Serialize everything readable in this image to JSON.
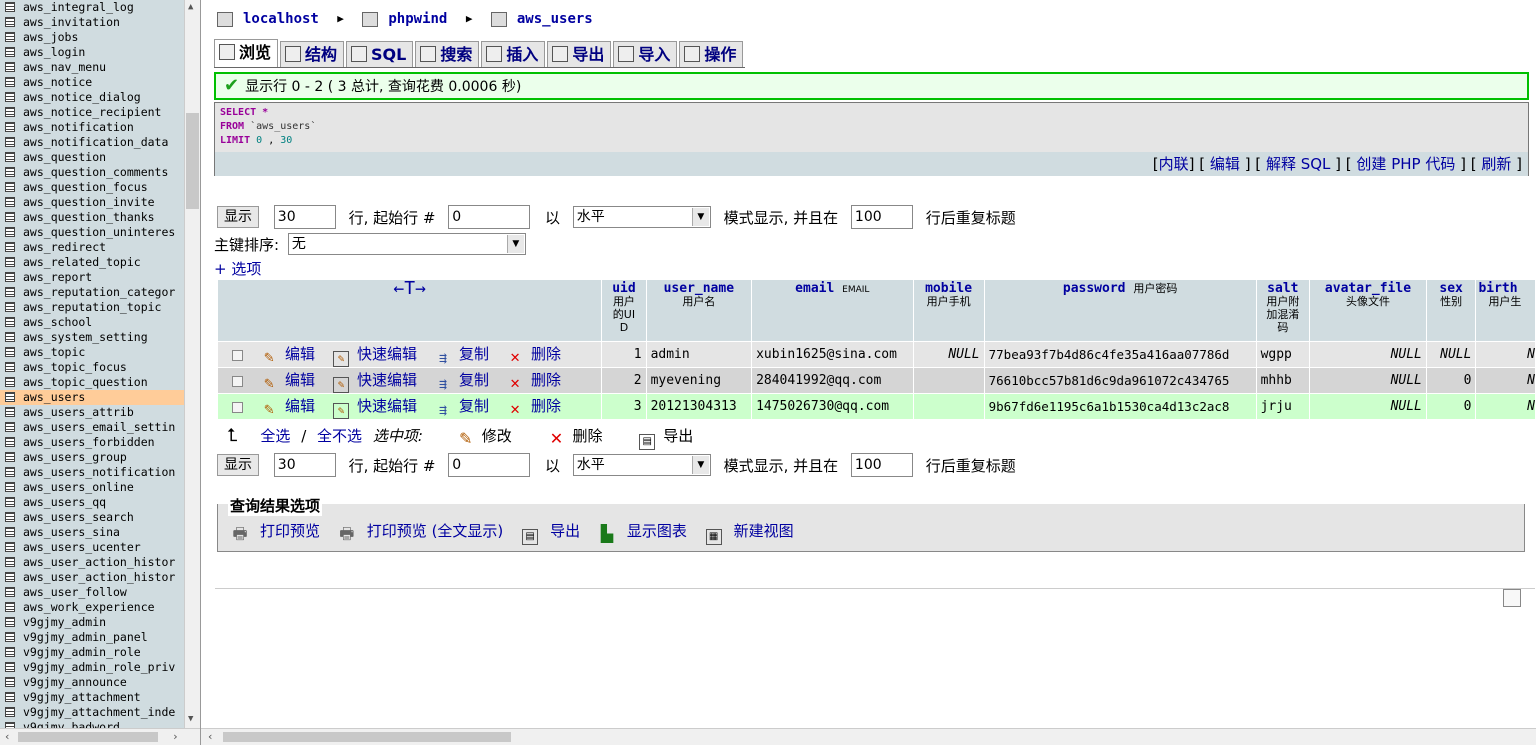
{
  "sidebar": {
    "tables": [
      "aws_integral_log",
      "aws_invitation",
      "aws_jobs",
      "aws_login",
      "aws_nav_menu",
      "aws_notice",
      "aws_notice_dialog",
      "aws_notice_recipient",
      "aws_notification",
      "aws_notification_data",
      "aws_question",
      "aws_question_comments",
      "aws_question_focus",
      "aws_question_invite",
      "aws_question_thanks",
      "aws_question_uninteres",
      "aws_redirect",
      "aws_related_topic",
      "aws_report",
      "aws_reputation_categor",
      "aws_reputation_topic",
      "aws_school",
      "aws_system_setting",
      "aws_topic",
      "aws_topic_focus",
      "aws_topic_question",
      "aws_users",
      "aws_users_attrib",
      "aws_users_email_settin",
      "aws_users_forbidden",
      "aws_users_group",
      "aws_users_notification",
      "aws_users_online",
      "aws_users_qq",
      "aws_users_search",
      "aws_users_sina",
      "aws_users_ucenter",
      "aws_user_action_histor",
      "aws_user_action_histor",
      "aws_user_follow",
      "aws_work_experience",
      "v9gjmy_admin",
      "v9gjmy_admin_panel",
      "v9gjmy_admin_role",
      "v9gjmy_admin_role_priv",
      "v9gjmy_announce",
      "v9gjmy_attachment",
      "v9gjmy_attachment_inde",
      "v9gjmy_badword"
    ],
    "active_index": 26
  },
  "breadcrumb": {
    "server": "localhost",
    "database": "phpwind",
    "table": "aws_users"
  },
  "tabs": [
    "浏览",
    "结构",
    "SQL",
    "搜索",
    "插入",
    "导出",
    "导入",
    "操作"
  ],
  "notice": "显示行 0 - 2 ( 3 总计, 查询花费 0.0006 秒)",
  "sql": {
    "select": "SELECT",
    "star": "*",
    "from": "FROM",
    "table": "`aws_users`",
    "limit": "LIMIT",
    "limit_a": "0",
    "comma": ",",
    "limit_b": "30",
    "links": [
      "内联",
      "编辑",
      "解释 SQL",
      "创建 PHP 代码",
      "刷新"
    ]
  },
  "controls": {
    "show_button": "显示",
    "rows": "30",
    "start_label": "行, 起始行 #",
    "start": "0",
    "in_label": "以",
    "mode": "水平",
    "mode_label": "模式显示, 并且在",
    "repeat": "100",
    "repeat_label": "行后重复标题",
    "sort_label": "主键排序:",
    "sort_value": "无",
    "options_link": "+ 选项"
  },
  "table": {
    "arrows": "←T→",
    "columns": [
      {
        "name": "uid",
        "comment": "用户的UID"
      },
      {
        "name": "user_name",
        "comment": "用户名"
      },
      {
        "name": "email",
        "comment": "EMAIL"
      },
      {
        "name": "mobile",
        "comment": "用户手机"
      },
      {
        "name": "password",
        "comment": "用户密码"
      },
      {
        "name": "salt",
        "comment": "用户附加混淆码"
      },
      {
        "name": "avatar_file",
        "comment": "头像文件"
      },
      {
        "name": "sex",
        "comment": "性别"
      },
      {
        "name": "birth",
        "comment": "用户生"
      }
    ],
    "actions": {
      "edit": "编辑",
      "quick_edit": "快速编辑",
      "copy": "复制",
      "delete": "删除"
    },
    "null_text": "NULL",
    "rows": [
      {
        "uid": "1",
        "user_name": "admin",
        "email": "xubin1625@sina.com",
        "mobile": "NULL",
        "password": "77bea93f7b4d86c4fe35a416aa07786d",
        "salt": "wgpp",
        "avatar_file": "NULL",
        "sex": "NULL",
        "birth": "N"
      },
      {
        "uid": "2",
        "user_name": "myevening",
        "email": "284041992@qq.com",
        "mobile": "",
        "password": "76610bcc57b81d6c9da961072c434765",
        "salt": "mhhb",
        "avatar_file": "NULL",
        "sex": "0",
        "birth": "N"
      },
      {
        "uid": "3",
        "user_name": "20121304313",
        "email": "1475026730@qq.com",
        "mobile": "",
        "password": "9b67fd6e1195c6a1b1530ca4d13c2ac8",
        "salt": "jrju",
        "avatar_file": "NULL",
        "sex": "0",
        "birth": "N"
      }
    ]
  },
  "with_selected": {
    "check_all": "全选",
    "slash": "/",
    "uncheck_all": "全不选",
    "label": "选中项:",
    "modify": "修改",
    "delete": "删除",
    "export": "导出"
  },
  "query_options": {
    "legend": "查询结果选项",
    "print": "打印预览",
    "print_full": "打印预览 (全文显示)",
    "export": "导出",
    "chart": "显示图表",
    "view": "新建视图"
  }
}
